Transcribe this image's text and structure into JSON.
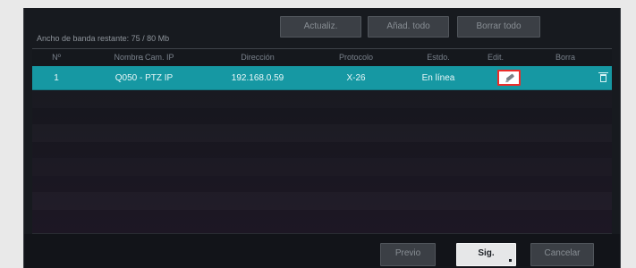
{
  "toolbar": {
    "bandwidth_text": "Ancho de banda restante: 75 / 80 Mb",
    "refresh_label": "Actualiz.",
    "add_all_label": "Añad. todo",
    "delete_all_label": "Borrar todo"
  },
  "table": {
    "headers": {
      "number": "Nº",
      "camera_name": "Nombre Cam. IP",
      "address": "Dirección",
      "protocol": "Protocolo",
      "status": "Estdo.",
      "edit": "Edit.",
      "delete": "Borra"
    },
    "rows": [
      {
        "number": "1",
        "camera_name": "Q050 - PTZ IP",
        "address": "192.168.0.59",
        "protocol": "X-26",
        "status": "En línea"
      }
    ]
  },
  "footer": {
    "previous_label": "Previo",
    "next_label": "Sig.",
    "cancel_label": "Cancelar"
  },
  "icons": {
    "sort": "sort-down-icon",
    "edit": "pencil-edit-icon",
    "delete": "trash-icon"
  },
  "colors": {
    "selected_row": "#1698a3",
    "highlight": "#ed2d2a",
    "background": "#171a1f"
  }
}
